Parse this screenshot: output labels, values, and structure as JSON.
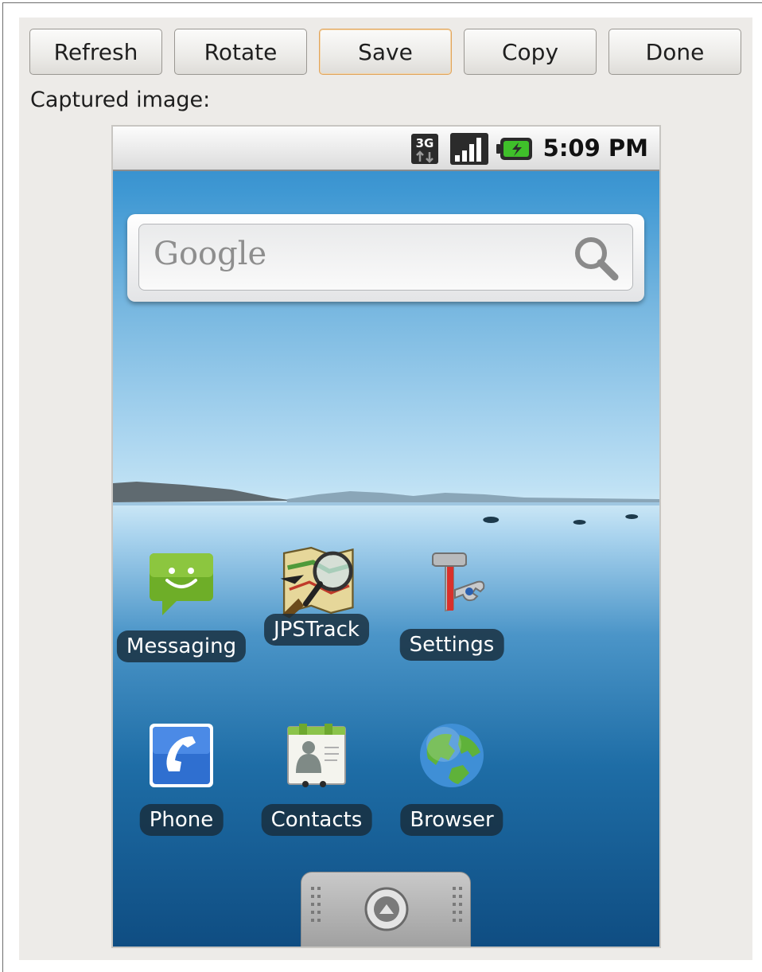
{
  "toolbar": {
    "refresh_label": "Refresh",
    "rotate_label": "Rotate",
    "save_label": "Save",
    "copy_label": "Copy",
    "done_label": "Done"
  },
  "caption": "Captured image:",
  "phone": {
    "status_bar": {
      "time": "5:09 PM",
      "network_icon": "3g-icon",
      "signal_icon": "signal-strength-icon",
      "battery_icon": "battery-charging-icon"
    },
    "search_widget": {
      "logo_text": "Google",
      "icon": "search-icon"
    },
    "apps": [
      {
        "label": "Messaging",
        "icon": "messaging-icon"
      },
      {
        "label": "JPSTrack",
        "icon": "jpstrack-icon"
      },
      {
        "label": "Settings",
        "icon": "settings-icon"
      },
      {
        "label": "Phone",
        "icon": "phone-icon"
      },
      {
        "label": "Contacts",
        "icon": "contacts-icon"
      },
      {
        "label": "Browser",
        "icon": "browser-icon"
      }
    ],
    "drawer_icon": "app-drawer-icon"
  },
  "colors": {
    "focused_button_border": "#e1a45a",
    "window_background": "#edebe8"
  }
}
